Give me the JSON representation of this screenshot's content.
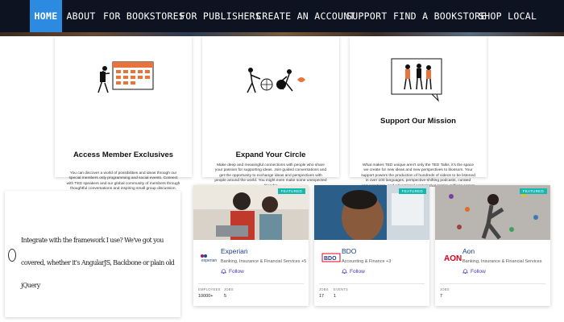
{
  "nav": {
    "items": [
      {
        "label": "HOME",
        "active": true
      },
      {
        "label": "ABOUT"
      },
      {
        "label": "FOR BOOKSTORES"
      },
      {
        "label": "FOR PUBLISHERS"
      },
      {
        "label": "CREATE AN ACCOUNT"
      },
      {
        "label": "SUPPORT"
      },
      {
        "label": "FIND A BOOKSTORE"
      },
      {
        "label": "SHOP LOCAL"
      }
    ],
    "active_color": "#2c8be0"
  },
  "features": [
    {
      "title": "Access Member Exclusives",
      "body": "You can discover a world of possibilities and ideas through our special members only programming and social events. Connect with TED speakers and our global community of members through thoughtful conversations and inspiring small group discussion."
    },
    {
      "title": "Expand Your Circle",
      "body": "Make deep and meaningful connections with people who share your passion for supporting ideas. Join guided conversations and get the opportunity to exchange ideas and perspectives with people around the world. You might even make some unexpected friends!"
    },
    {
      "title": "Support Our Mission",
      "body": "What makes TED unique aren't only the TED Talks, it's the space we create for new ideas and new perspectives to blossom. Your support powers the production of hundreds of videos to be listened in over 100 languages, perspective-shifting podcasts, curated conversations, and educational content that inspire millions across the globe."
    }
  ],
  "text_widget": {
    "text": "Integrate with the framework I use? We've got you covered, whether it's AngularJS, Backbone or plain old jQuery"
  },
  "companies": [
    {
      "badge": "FEATURED",
      "name": "Experian",
      "logo_text": "experian",
      "category": "Banking, Insurance & Financial Services +5",
      "follow": "Follow",
      "stats": [
        {
          "label": "EMPLOYEES",
          "value": "10000+"
        },
        {
          "label": "JOBS",
          "value": "5"
        }
      ]
    },
    {
      "badge": "FEATURED",
      "name": "BDO",
      "logo_text": "BDO",
      "category": "Accounting & Finance +3",
      "follow": "Follow",
      "stats": [
        {
          "label": "JOBS",
          "value": "17"
        },
        {
          "label": "EVENTS",
          "value": "1"
        }
      ]
    },
    {
      "badge": "FEATURED",
      "name": "Aon",
      "logo_text": "AON",
      "category": "Banking, Insurance & Financial Services",
      "follow": "Follow",
      "stats": [
        {
          "label": "JOBS",
          "value": "7"
        }
      ]
    }
  ],
  "colors": {
    "nav_bg": "#0d1320",
    "badge": "#14b8b0",
    "link": "#1a3e8c",
    "follow": "#3d35c8"
  }
}
